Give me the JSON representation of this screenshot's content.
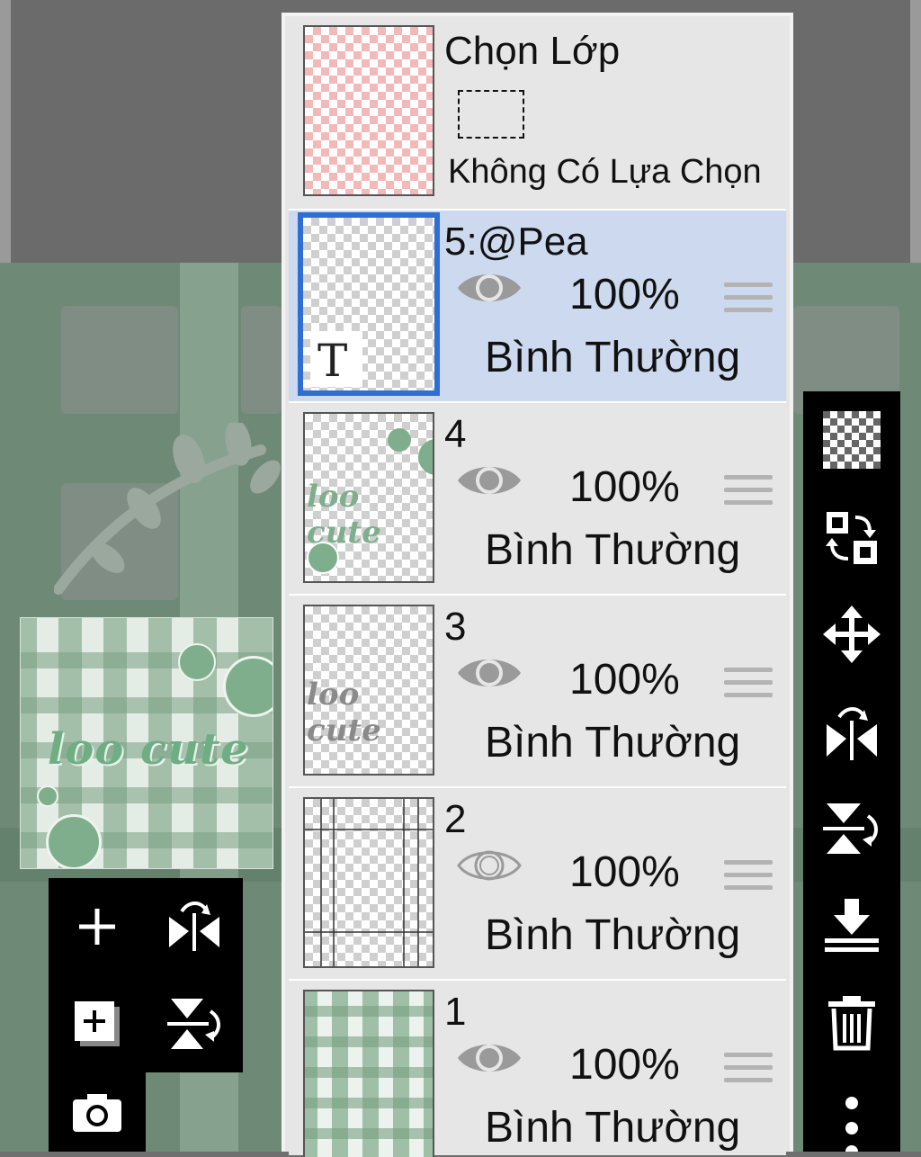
{
  "selection_layer": {
    "title": "Chọn Lớp",
    "status": "Không Có Lựa Chọn"
  },
  "layers": [
    {
      "name": "5:@Pea",
      "opacity": "100%",
      "blend": "Bình Thường",
      "visible": true,
      "active": true,
      "type_glyph": "T"
    },
    {
      "name": "4",
      "opacity": "100%",
      "blend": "Bình Thường",
      "visible": true,
      "active": false
    },
    {
      "name": "3",
      "opacity": "100%",
      "blend": "Bình Thường",
      "visible": true,
      "active": false
    },
    {
      "name": "2",
      "opacity": "100%",
      "blend": "Bình Thường",
      "visible": false,
      "active": false
    },
    {
      "name": "1",
      "opacity": "100%",
      "blend": "Bình Thường",
      "visible": true,
      "active": false
    }
  ],
  "preview": {
    "text": "loo cute"
  },
  "left_toolbar": [
    "add-layer-icon",
    "flip-horizontal-icon",
    "add-layer-copy-icon",
    "flip-vertical-icon",
    "camera-icon"
  ],
  "right_toolbar": [
    "transparency-icon",
    "swap-layers-icon",
    "move-icon",
    "flip-horizontal-icon",
    "flip-vertical-icon",
    "merge-down-icon",
    "trash-icon",
    "more-options-icon"
  ],
  "colors": {
    "active_layer_bg": "#cdd9ee",
    "active_border": "#2f6fd3",
    "panel_bg": "#e6e6e6",
    "canvas_green": "#6e8a77"
  }
}
